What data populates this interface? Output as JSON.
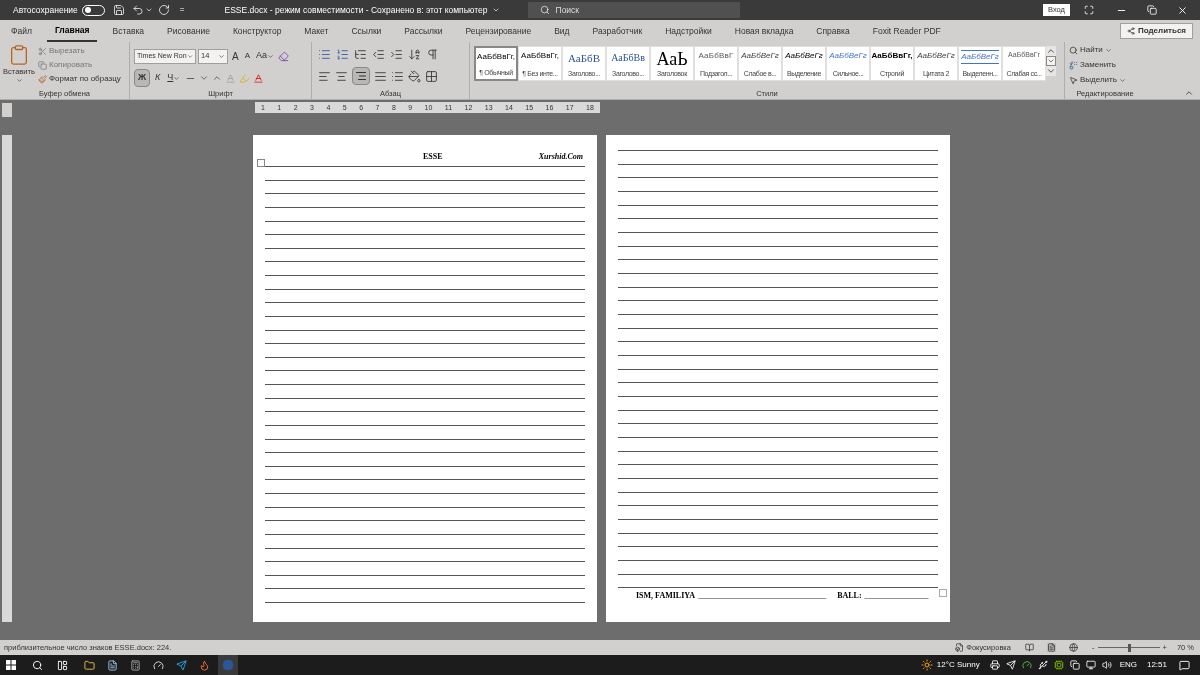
{
  "title_bar": {
    "autosave_label": "Автосохранение",
    "autosave_on": false,
    "customize": "=",
    "title": "ESSE.docx  -  режим совместимости  -  Сохранено в: этот компьютер",
    "search_placeholder": "Поиск",
    "sign_in": "Вход"
  },
  "tabs": [
    {
      "label": "Файл",
      "selected": false
    },
    {
      "label": "Главная",
      "selected": true
    },
    {
      "label": "Вставка",
      "selected": false
    },
    {
      "label": "Рисование",
      "selected": false
    },
    {
      "label": "Конструктор",
      "selected": false
    },
    {
      "label": "Макет",
      "selected": false
    },
    {
      "label": "Ссылки",
      "selected": false
    },
    {
      "label": "Рассылки",
      "selected": false
    },
    {
      "label": "Рецензирование",
      "selected": false
    },
    {
      "label": "Вид",
      "selected": false
    },
    {
      "label": "Разработчик",
      "selected": false
    },
    {
      "label": "Надстройки",
      "selected": false
    },
    {
      "label": "Новая вкладка",
      "selected": false
    },
    {
      "label": "Справка",
      "selected": false
    },
    {
      "label": "Foxit Reader PDF",
      "selected": false
    }
  ],
  "share": "Поделиться",
  "clipboard": {
    "paste": "Вставить",
    "cut": "Вырезать",
    "copy": "Копировать",
    "format_painter": "Формат по образцу",
    "group": "Буфер обмена"
  },
  "font": {
    "name": "Times New Ron",
    "size": "14",
    "grow": "A",
    "shrink": "A",
    "case": "Aa",
    "bold": "Ж",
    "italic": "К",
    "underline": "Ч",
    "bold_on": true,
    "group": "Шрифт"
  },
  "paragraph": {
    "group": "Абзац",
    "align_right_on": true
  },
  "styles": {
    "group": "Стили",
    "items": [
      {
        "kind": "normal",
        "sample": "АаБбВвГг,",
        "name": "¶ Обычный",
        "selected": true
      },
      {
        "kind": "normal",
        "sample": "АаБбВвГг,",
        "name": "¶ Без инте...",
        "selected": false
      },
      {
        "kind": "heading1",
        "sample": "АаБбВ",
        "name": "Заголово...",
        "selected": false
      },
      {
        "kind": "heading2",
        "sample": "АаБбВв",
        "name": "Заголово...",
        "selected": false
      },
      {
        "kind": "title",
        "sample": "АаЬ",
        "name": "Заголовок",
        "selected": false
      },
      {
        "kind": "subtitle",
        "sample": "АаБбВвГ",
        "name": "Подзагол...",
        "selected": false
      },
      {
        "kind": "subtle",
        "sample": "АаБбВеГг",
        "name": "Слабое в...",
        "selected": false
      },
      {
        "kind": "emphasis",
        "sample": "АаБбВеГг",
        "name": "Выделение",
        "selected": false
      },
      {
        "kind": "intense",
        "sample": "АаБбВеГг",
        "name": "Сильное...",
        "selected": false
      },
      {
        "kind": "strong",
        "sample": "АаБбВвГг,",
        "name": "Строгий",
        "selected": false
      },
      {
        "kind": "quote",
        "sample": "АаБбВеГг",
        "name": "Цитата 2",
        "selected": false
      },
      {
        "kind": "intense_quote",
        "sample": "АаБбВеГг",
        "name": "Выделенн...",
        "selected": false
      },
      {
        "kind": "subtle_ref",
        "sample": "АаБбВвГг",
        "name": "Слабая сс...",
        "selected": false
      }
    ]
  },
  "editing": {
    "find": "Найти",
    "replace": "Заменить",
    "select": "Выделить",
    "group": "Редактирование"
  },
  "ruler": [
    "1",
    "1",
    "2",
    "3",
    "4",
    "5",
    "6",
    "7",
    "8",
    "9",
    "10",
    "11",
    "12",
    "13",
    "14",
    "15",
    "16",
    "17",
    "18"
  ],
  "page_1": {
    "header_title": "ESSE",
    "header_site": "Xurshid.Com"
  },
  "page_2": {
    "name_label": "ISM, FAMILIYA",
    "name_blank": "________________________________",
    "score_label": "BALL:",
    "score_blank": "________________"
  },
  "status_bar": {
    "char_count": "приблизительное число знаков ESSE.docx: 224.",
    "focus": "Фокусировка",
    "zoom_minus": "-",
    "zoom_plus": "+",
    "zoom": {
      "level": 0.5
    },
    "zoom_percent": "70 %"
  },
  "taskbar": {
    "weather": "12°C Sunny",
    "language": "ENG",
    "time": "12:51"
  }
}
